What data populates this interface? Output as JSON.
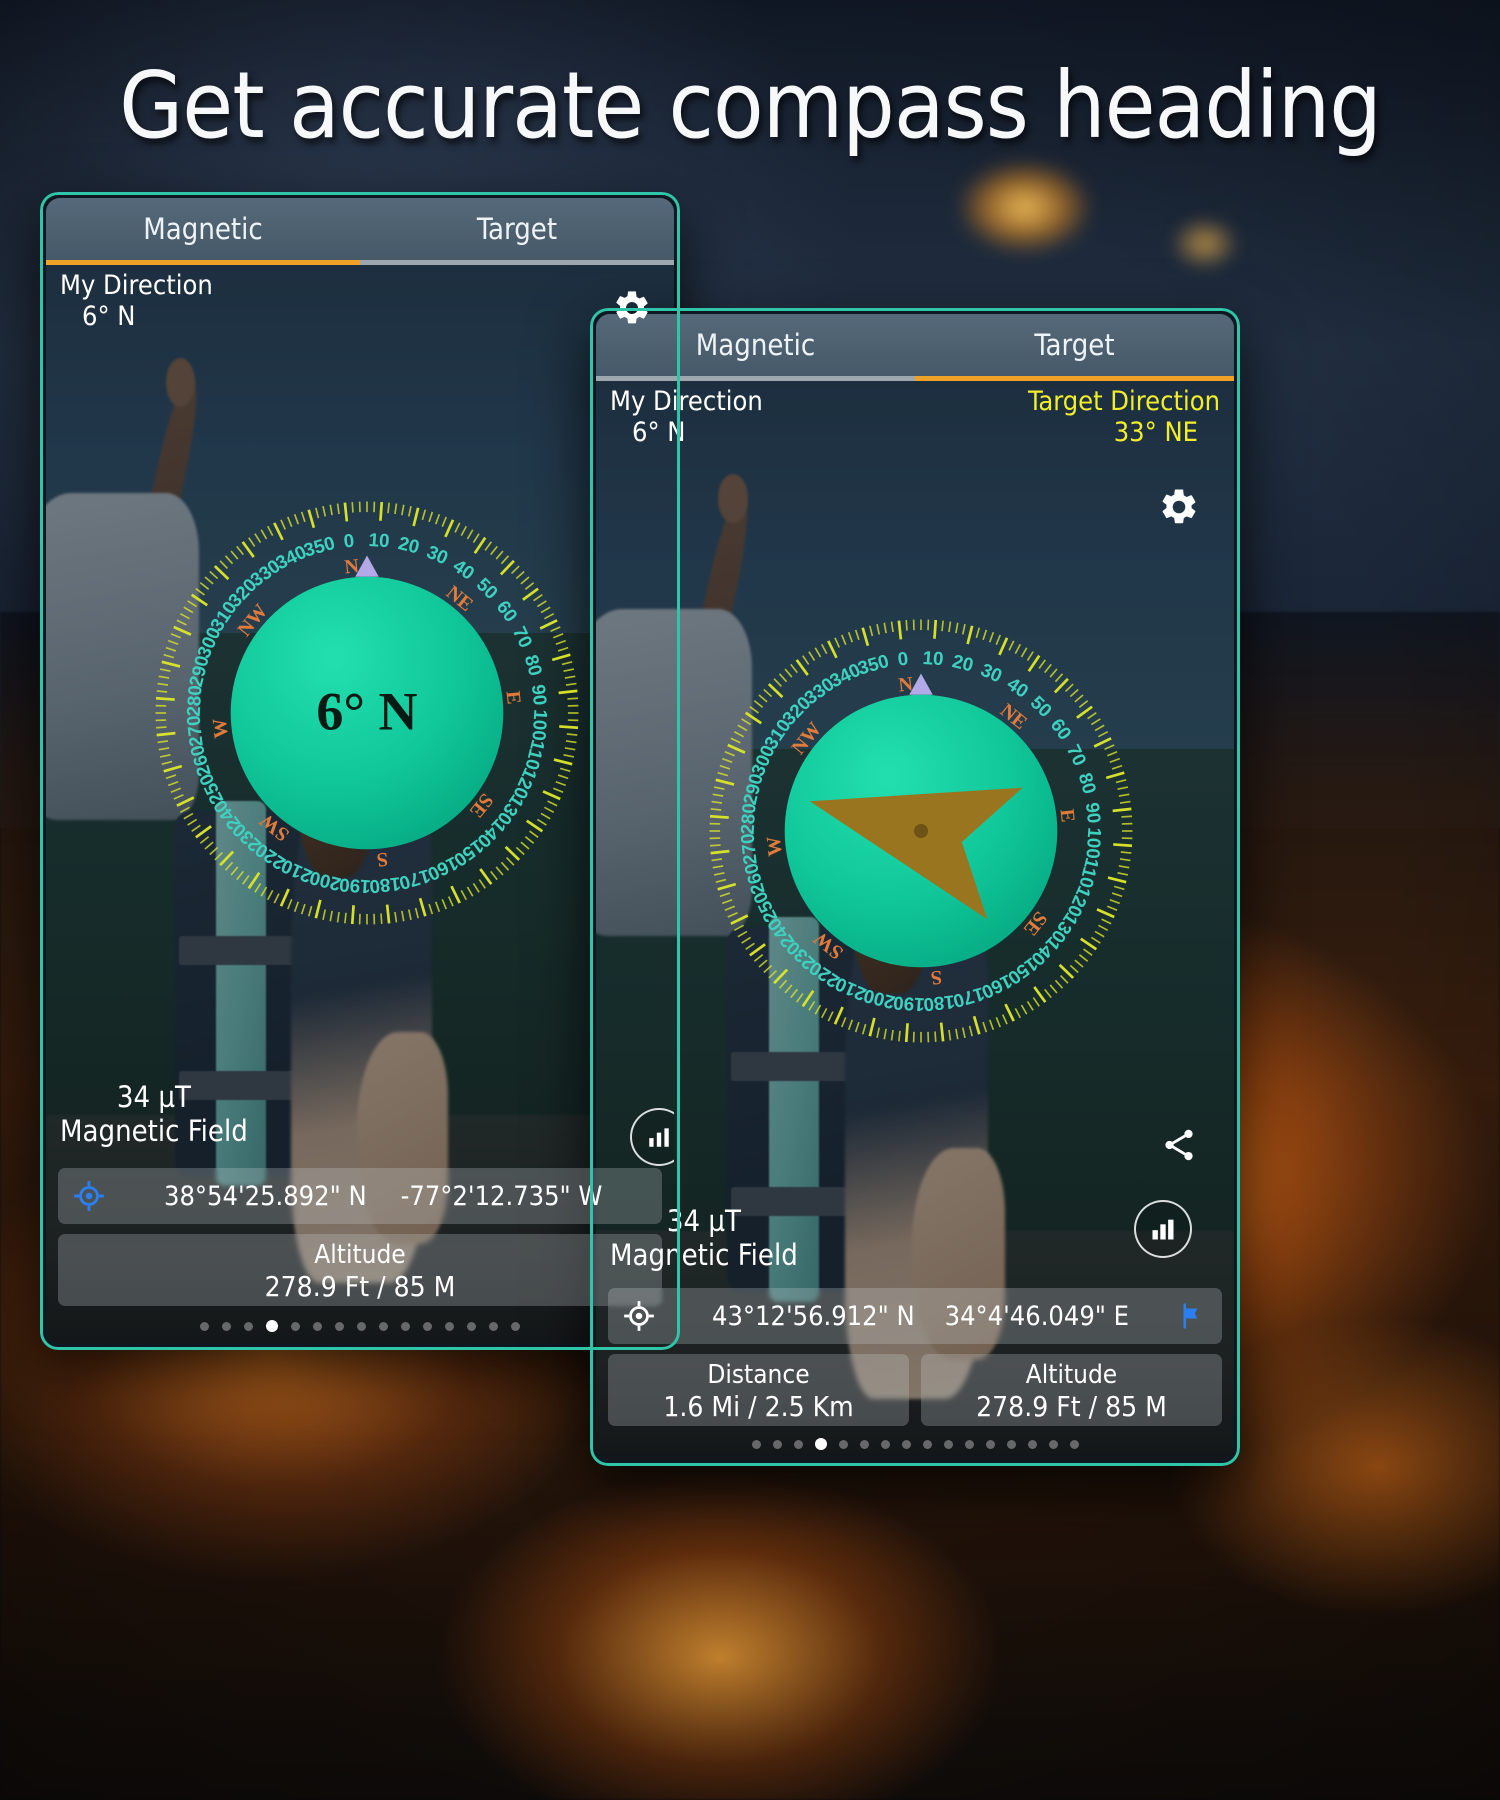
{
  "headline": "Get accurate compass heading",
  "colors": {
    "accent_teal": "#2ec5a8",
    "compass_face": "#0fc699",
    "tab_active_underline": "#f0a128",
    "tab_inactive_underline": "#9ea7ae",
    "target_yellow": "#f2ee2a",
    "dial_ticks": "#d8e32a",
    "dial_degrees": "#3fd1c0",
    "dial_cardinals": "#e07b3c",
    "needle_gold": "#9a7520",
    "pointer_lavender": "#b3a8e8",
    "gps_blue": "#2a7ff5",
    "flag_blue": "#2a7ff5"
  },
  "phone1": {
    "tabs": [
      {
        "label": "Magnetic",
        "active": true
      },
      {
        "label": "Target",
        "active": false
      }
    ],
    "my_direction": {
      "title": "My Direction",
      "value": "6° N"
    },
    "compass": {
      "center_text": "6° N",
      "degree_labels": [
        "0",
        "10",
        "20",
        "30",
        "40",
        "50",
        "60",
        "70",
        "80",
        "90",
        "100",
        "110",
        "120",
        "130",
        "140",
        "150",
        "160",
        "170",
        "180",
        "190",
        "200",
        "210",
        "220",
        "230",
        "240",
        "250",
        "260",
        "270",
        "280",
        "290",
        "300",
        "310",
        "320",
        "330",
        "340",
        "350"
      ],
      "cardinals": [
        "N",
        "NE",
        "E",
        "SE",
        "S",
        "SW",
        "W",
        "NW"
      ],
      "heading_deg": 6,
      "has_needle": false
    },
    "magnetic_field": {
      "value": "34 µT",
      "label": "Magnetic Field"
    },
    "coordinates": {
      "lat": "38°54'25.892\" N",
      "lon": "-77°2'12.735\" W",
      "icon": "gps-target-icon"
    },
    "altitude": {
      "label": "Altitude",
      "value": "278.9  Ft / 85 M"
    },
    "pager": {
      "count": 15,
      "active_index": 3
    },
    "icons": [
      "gear-icon"
    ]
  },
  "phone2": {
    "tabs": [
      {
        "label": "Magnetic",
        "active": false
      },
      {
        "label": "Target",
        "active": true
      }
    ],
    "my_direction": {
      "title": "My Direction",
      "value": "6° N"
    },
    "target_direction": {
      "title": "Target Direction",
      "value": "33° NE"
    },
    "compass": {
      "center_text": "",
      "degree_labels": [
        "0",
        "10",
        "20",
        "30",
        "40",
        "50",
        "60",
        "70",
        "80",
        "90",
        "100",
        "110",
        "120",
        "130",
        "140",
        "150",
        "160",
        "170",
        "180",
        "190",
        "200",
        "210",
        "220",
        "230",
        "240",
        "250",
        "260",
        "270",
        "280",
        "290",
        "300",
        "310",
        "320",
        "330",
        "340",
        "350"
      ],
      "cardinals": [
        "N",
        "NE",
        "E",
        "SE",
        "S",
        "SW",
        "W",
        "NW"
      ],
      "heading_deg": 6,
      "has_needle": true,
      "needle_angle_deg": -75
    },
    "magnetic_field": {
      "value": "34 µT",
      "label": "Magnetic Field"
    },
    "coordinates": {
      "lat": "43°12'56.912\" N",
      "lon": "34°4'46.049\" E",
      "icon": "gps-target-icon",
      "flag_icon": "flag-icon"
    },
    "distance": {
      "label": "Distance",
      "value": "1.6 Mi / 2.5 Km"
    },
    "altitude": {
      "label": "Altitude",
      "value": "278.9  Ft / 85 M"
    },
    "pager": {
      "count": 16,
      "active_index": 3
    },
    "icons": [
      "gear-icon",
      "share-icon",
      "chart-icon"
    ]
  }
}
